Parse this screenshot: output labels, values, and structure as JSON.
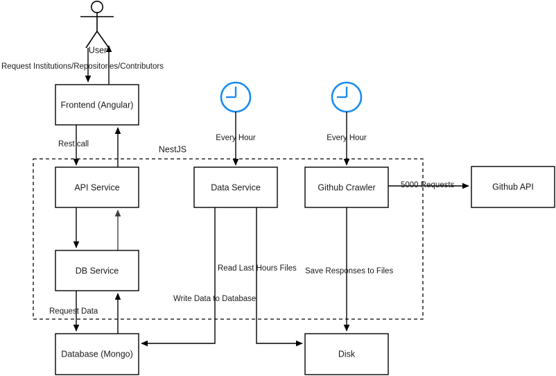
{
  "diagram": {
    "title": "System Architecture",
    "background_color": "#ffffff",
    "stroke_color": "#000000",
    "accent_color": "#1a8cf0"
  },
  "actor": {
    "label": "User",
    "icon": "stick-figure-actor-icon"
  },
  "group": {
    "label": "NestJS",
    "style": "dashed"
  },
  "nodes": {
    "frontend": {
      "label": "Frontend (Angular)"
    },
    "api_service": {
      "label": "API Service"
    },
    "db_service": {
      "label": "DB Service"
    },
    "data_service": {
      "label": "Data Service"
    },
    "github_crawler": {
      "label": "Github Crawler"
    },
    "github_api": {
      "label": "Github API"
    },
    "database": {
      "label": "Database (Mongo)"
    },
    "disk": {
      "label": "Disk"
    }
  },
  "schedulers": {
    "data_service_timer": {
      "icon": "clock-icon",
      "label": "Every Hour",
      "color": "#1a8cf0"
    },
    "crawler_timer": {
      "icon": "clock-icon",
      "label": "Every Hour",
      "color": "#1a8cf0"
    }
  },
  "edges": {
    "user_to_frontend": {
      "label": "Request Institutions/Repositories/Contributors"
    },
    "frontend_to_api": {
      "label": "Rest call"
    },
    "db_service_to_database": {
      "label": "Request Data"
    },
    "crawler_to_github_api": {
      "label": "5000 Requests"
    },
    "data_service_read": {
      "label": "Read Last Hours Files"
    },
    "data_service_write": {
      "label": "Write Data to Database"
    },
    "crawler_save": {
      "label": "Save Responses to Files"
    }
  }
}
